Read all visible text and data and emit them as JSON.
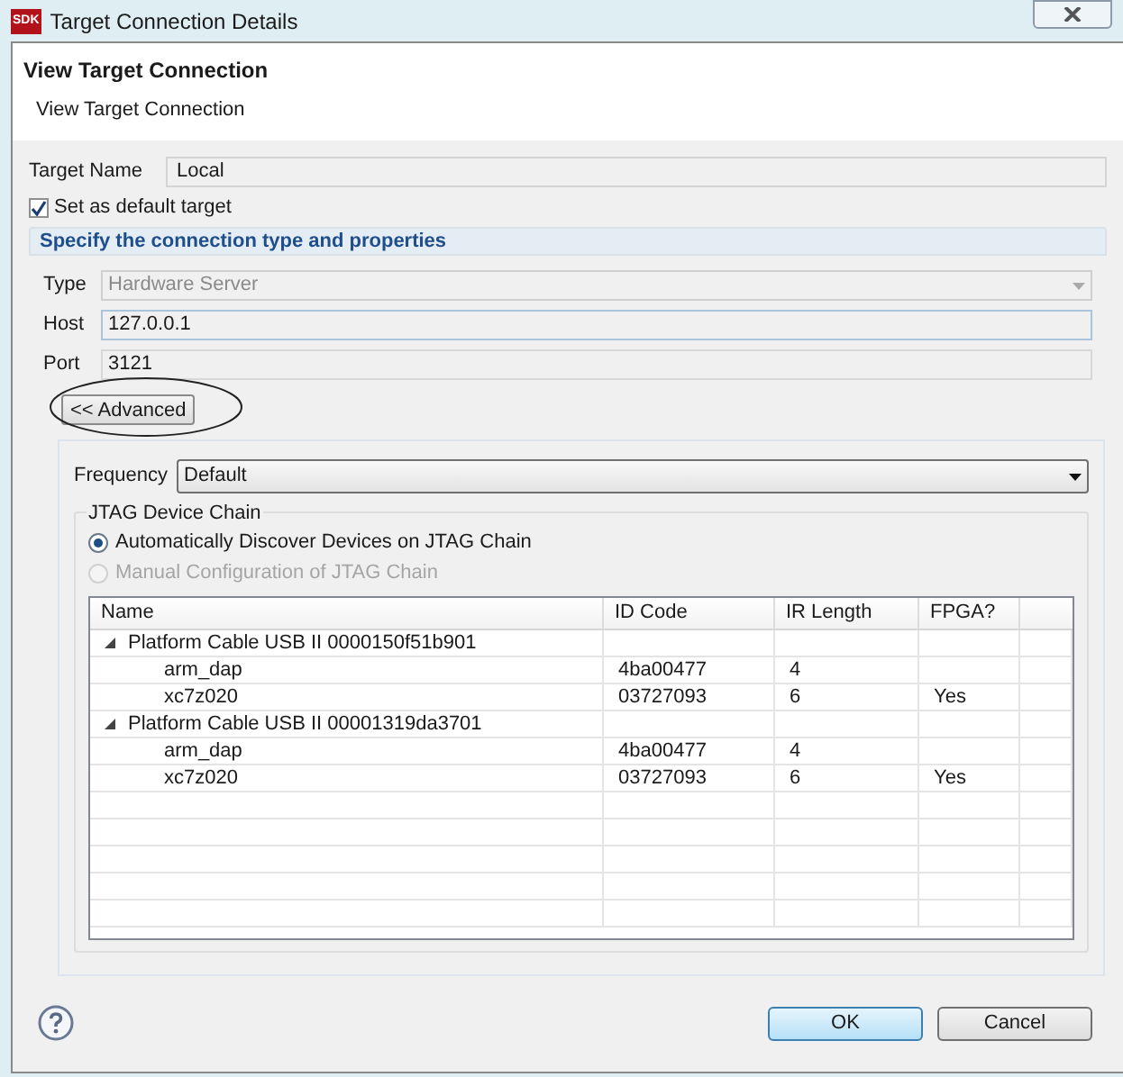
{
  "window": {
    "title": "Target Connection Details",
    "logo": "SDK"
  },
  "header": {
    "title": "View Target Connection",
    "subtitle": "View Target Connection"
  },
  "target_name": {
    "label": "Target Name",
    "value": "Local"
  },
  "default_target": {
    "label": "Set as default target",
    "checked": true
  },
  "section": {
    "title": "Specify the connection type and properties"
  },
  "type": {
    "label": "Type",
    "value": "Hardware Server",
    "disabled": true
  },
  "host": {
    "label": "Host",
    "value": "127.0.0.1"
  },
  "port": {
    "label": "Port",
    "value": "3121"
  },
  "advanced_button": {
    "label": "<< Advanced"
  },
  "frequency": {
    "label": "Frequency",
    "value": "Default"
  },
  "jtag": {
    "title": "JTAG Device Chain",
    "options": [
      {
        "label": "Automatically Discover Devices on JTAG Chain",
        "selected": true,
        "disabled": false
      },
      {
        "label": "Manual Configuration of JTAG Chain",
        "selected": false,
        "disabled": true
      }
    ]
  },
  "table": {
    "columns": [
      "Name",
      "ID Code",
      "IR Length",
      "FPGA?"
    ],
    "rows": [
      {
        "name": "Platform Cable USB II 0000150f51b901",
        "expanded": true,
        "children": [
          {
            "name": "arm_dap",
            "id_code": "4ba00477",
            "ir_length": "4"
          },
          {
            "name": "xc7z020",
            "id_code": "03727093",
            "ir_length": "6",
            "fpga": "Yes"
          }
        ]
      },
      {
        "name": "Platform Cable USB II 00001319da3701",
        "expanded": true,
        "children": [
          {
            "name": "arm_dap",
            "id_code": "4ba00477",
            "ir_length": "4"
          },
          {
            "name": "xc7z020",
            "id_code": "03727093",
            "ir_length": "6",
            "fpga": "Yes"
          }
        ]
      }
    ]
  },
  "buttons": [
    {
      "label": "OK",
      "kind": "default"
    },
    {
      "label": "Cancel",
      "kind": "normal"
    }
  ]
}
